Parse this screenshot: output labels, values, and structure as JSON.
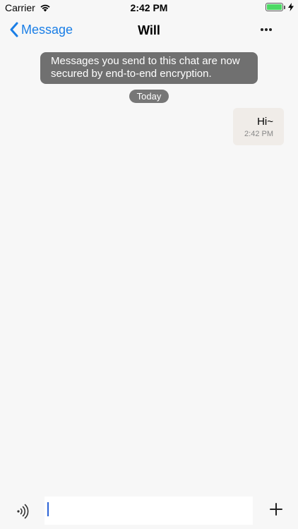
{
  "status_bar": {
    "carrier": "Carrier",
    "time": "2:42 PM",
    "battery_level": 1.0,
    "icons": [
      "wifi-icon",
      "battery-icon",
      "charging-bolt-icon"
    ]
  },
  "nav": {
    "back_label": "Message",
    "title": "Will",
    "icons": [
      "chevron-left-icon",
      "more-icon"
    ]
  },
  "chat": {
    "encryption_notice_line1": "Messages you send to this chat are now",
    "encryption_notice_line2": "secured by end-to-end encryption.",
    "date_label": "Today",
    "messages": [
      {
        "text": "Hi~",
        "time": "2:42 PM",
        "outgoing": true
      }
    ]
  },
  "composer": {
    "input_value": "",
    "input_placeholder": "",
    "icons": [
      "voice-icon",
      "plus-icon"
    ]
  },
  "colors": {
    "accent": "#1a7ee6",
    "notice_bg": "#707070",
    "bubble_bg": "#f0ece8",
    "battery": "#4cd964"
  }
}
